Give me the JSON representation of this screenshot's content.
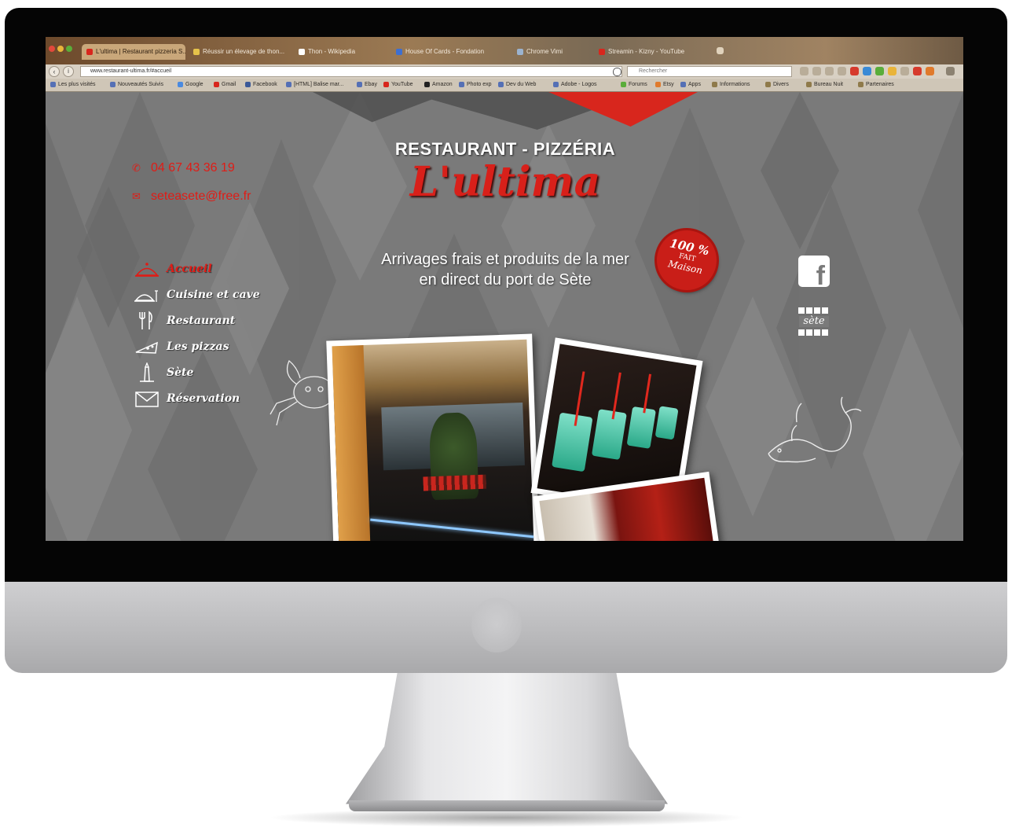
{
  "browser": {
    "tabs": [
      {
        "label": "L'ultima | Restaurant pizzeria S...",
        "active": true
      },
      {
        "label": "Réussir un élevage de thon...",
        "active": false
      },
      {
        "label": "Thon - Wikipedia",
        "active": false
      },
      {
        "label": "House Of Cards - Fondation",
        "active": false
      },
      {
        "label": "Chrome Vimi",
        "active": false
      },
      {
        "label": "Streamin - Kizny - YouTube",
        "active": false
      }
    ],
    "url": "www.restaurant-ultima.fr/#accueil",
    "search_placeholder": "Rechercher",
    "bookmarks": [
      "Les plus visités",
      "Nouveautés Suivis",
      "Google",
      "Gmail",
      "Facebook",
      "[HTML] Balise mar...",
      "Ebay",
      "YouTube",
      "Amazon",
      "Photo exp",
      "Dev du Web",
      "Adobe - Logos",
      "Forums",
      "Etsy",
      "Apps",
      "Informations",
      "Divers",
      "Bureau Nuit",
      "Partenaires"
    ]
  },
  "site": {
    "phone": "04 67 43 36 19",
    "email": "seteasete@free.fr",
    "kicker": "RESTAURANT - PIZZÉRIA",
    "logo": "L'ultima",
    "tagline_line1": "Arrivages frais et produits de la mer",
    "tagline_line2": "en direct du port de Sète",
    "stamp": {
      "line1": "100 %",
      "line2": "FAIT",
      "line3": "Maison"
    },
    "menu": [
      {
        "label": "Accueil",
        "icon": "cloche-icon",
        "active": true
      },
      {
        "label": "Cuisine et cave",
        "icon": "serving-dish-icon",
        "active": false
      },
      {
        "label": "Restaurant",
        "icon": "cutlery-icon",
        "active": false
      },
      {
        "label": "Les pizzas",
        "icon": "pizza-slice-icon",
        "active": false
      },
      {
        "label": "Sète",
        "icon": "lighthouse-icon",
        "active": false
      },
      {
        "label": "Réservation",
        "icon": "envelope-icon",
        "active": false
      }
    ],
    "social": {
      "facebook_glyph": "f",
      "sete_label": "sète"
    },
    "colors": {
      "accent_red": "#e01c16",
      "background_grey": "#7a7a7a"
    }
  }
}
